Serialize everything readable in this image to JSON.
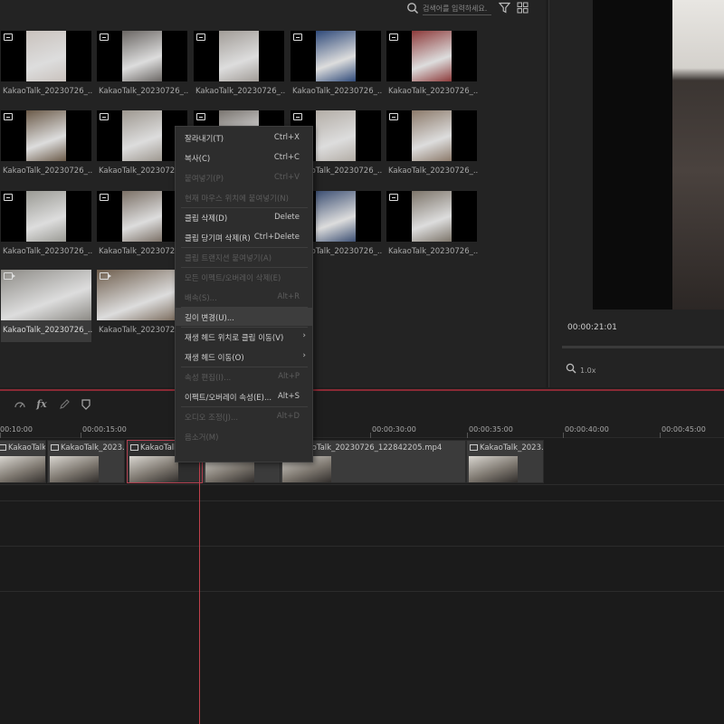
{
  "search": {
    "placeholder": "검색어를 입력하세요."
  },
  "library": {
    "clips": [
      {
        "name": "KakaoTalk_20230726_...",
        "type": "image",
        "color": "#c9c2bd"
      },
      {
        "name": "KakaoTalk_20230726_...",
        "type": "image",
        "color": "#6a6663"
      },
      {
        "name": "KakaoTalk_20230726_...",
        "type": "image",
        "color": "#a19c97"
      },
      {
        "name": "KakaoTalk_20230726_...",
        "type": "image",
        "color": "#2f4a7a"
      },
      {
        "name": "KakaoTalk_20230726_...",
        "type": "image",
        "color": "#8d3a3a"
      },
      {
        "name": "KakaoTalk_20230726_...",
        "type": "image",
        "color": "#6b5a48"
      },
      {
        "name": "KakaoTalk_20230726_...",
        "type": "image",
        "color": "#9e9890"
      },
      {
        "name": "KakaoTalk_20230726_...",
        "type": "image",
        "color": "#7a7570"
      },
      {
        "name": "KakaoTalk_20230726_...",
        "type": "image",
        "color": "#b3ada6"
      },
      {
        "name": "KakaoTalk_20230726_...",
        "type": "image",
        "color": "#8c7a6a"
      },
      {
        "name": "KakaoTalk_20230726_...",
        "type": "image",
        "color": "#9a9a94"
      },
      {
        "name": "KakaoTalk_20230726_...",
        "type": "image",
        "color": "#7b7066"
      },
      {
        "name": "KakaoTalk_20230726_...",
        "type": "image",
        "color": "#5a5a5a"
      },
      {
        "name": "KakaoTalk_20230726_...",
        "type": "image",
        "color": "#3c4f73"
      },
      {
        "name": "KakaoTalk_20230726_...",
        "type": "image",
        "color": "#7c7469"
      },
      {
        "name": "KakaoTalk_20230726_...",
        "type": "video",
        "color": "#8c8a85"
      },
      {
        "name": "KakaoTalk_20230726_...",
        "type": "video",
        "color": "#6e5d4c"
      },
      {
        "name": "KakaoTalk_20230726_...",
        "type": "video",
        "color": "#7d7368"
      }
    ]
  },
  "preview": {
    "timecode": "00:00:21:01",
    "zoom": "1.0x"
  },
  "timeline": {
    "ruler": [
      "00:10:00",
      "00:00:15:00",
      "00:00:30:00",
      "00:00:35:00",
      "00:00:40:00",
      "00:00:45:00"
    ],
    "clips": [
      {
        "label": "KakaoTalk_202..."
      },
      {
        "label": "KakaoTalk_2023..."
      },
      {
        "label": "KakaoTalk"
      },
      {
        "label": ""
      },
      {
        "label": "KakaoTalk_20230726_122842205.mp4"
      },
      {
        "label": "KakaoTalk_2023..."
      }
    ]
  },
  "context_menu": {
    "items": [
      {
        "label": "잘라내기(T)",
        "shortcut": "Ctrl+X",
        "enabled": true
      },
      {
        "label": "복사(C)",
        "shortcut": "Ctrl+C",
        "enabled": true
      },
      {
        "label": "붙여넣기(P)",
        "shortcut": "Ctrl+V",
        "enabled": false
      },
      {
        "label": "현재 마우스 위치에 붙여넣기(N)",
        "shortcut": "",
        "enabled": false
      },
      {
        "label": "클립 삭제(D)",
        "shortcut": "Delete",
        "enabled": true
      },
      {
        "label": "클립 당기며 삭제(R)",
        "shortcut": "Ctrl+Delete",
        "enabled": true
      },
      {
        "label": "클립 트랜지션 붙여넣기(A)",
        "shortcut": "",
        "enabled": false
      },
      {
        "label": "모든 이펙트/오버레이 삭제(E)",
        "shortcut": "",
        "enabled": false
      },
      {
        "label": "배속(S)...",
        "shortcut": "Alt+R",
        "enabled": false
      },
      {
        "label": "길이 변경(U)...",
        "shortcut": "",
        "enabled": true,
        "hover": true
      },
      {
        "label": "재생 헤드 위치로 클립 이동(V)",
        "shortcut": "",
        "enabled": true,
        "submenu": true
      },
      {
        "label": "재생 헤드 이동(O)",
        "shortcut": "",
        "enabled": true,
        "submenu": true
      },
      {
        "label": "속성 편집(I)...",
        "shortcut": "Alt+P",
        "enabled": false
      },
      {
        "label": "이펙트/오버레이 속성(E)...",
        "shortcut": "Alt+S",
        "enabled": true
      },
      {
        "label": "오디오 조정(J)...",
        "shortcut": "Alt+D",
        "enabled": false
      },
      {
        "label": "음소거(M)",
        "shortcut": "",
        "enabled": false
      }
    ]
  }
}
